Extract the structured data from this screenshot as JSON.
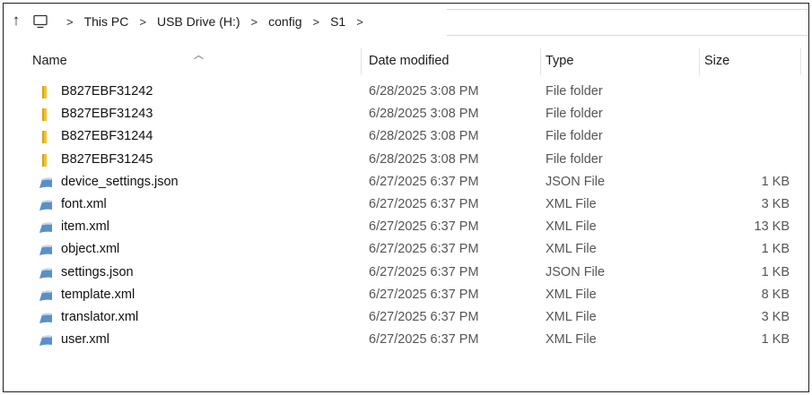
{
  "address_bar": {
    "up_icon": "arrow-up-icon",
    "pc_icon": "monitor-icon",
    "separator": ">",
    "crumbs": [
      "This PC",
      "USB Drive (H:)",
      "config",
      "S1"
    ]
  },
  "columns": {
    "name": "Name",
    "date_modified": "Date modified",
    "type": "Type",
    "size": "Size"
  },
  "rows": [
    {
      "icon": "folder-icon",
      "name": "B827EBF31242",
      "date": "6/28/2025 3:08 PM",
      "type": "File folder",
      "size": ""
    },
    {
      "icon": "folder-icon",
      "name": "B827EBF31243",
      "date": "6/28/2025 3:08 PM",
      "type": "File folder",
      "size": ""
    },
    {
      "icon": "folder-icon",
      "name": "B827EBF31244",
      "date": "6/28/2025 3:08 PM",
      "type": "File folder",
      "size": ""
    },
    {
      "icon": "folder-icon",
      "name": "B827EBF31245",
      "date": "6/28/2025 3:08 PM",
      "type": "File folder",
      "size": ""
    },
    {
      "icon": "file-icon",
      "name": "device_settings.json",
      "date": "6/27/2025 6:37 PM",
      "type": "JSON File",
      "size": "1 KB"
    },
    {
      "icon": "file-icon",
      "name": "font.xml",
      "date": "6/27/2025 6:37 PM",
      "type": "XML File",
      "size": "3 KB"
    },
    {
      "icon": "file-icon",
      "name": "item.xml",
      "date": "6/27/2025 6:37 PM",
      "type": "XML File",
      "size": "13 KB"
    },
    {
      "icon": "file-icon",
      "name": "object.xml",
      "date": "6/27/2025 6:37 PM",
      "type": "XML File",
      "size": "1 KB"
    },
    {
      "icon": "file-icon",
      "name": "settings.json",
      "date": "6/27/2025 6:37 PM",
      "type": "JSON File",
      "size": "1 KB"
    },
    {
      "icon": "file-icon",
      "name": "template.xml",
      "date": "6/27/2025 6:37 PM",
      "type": "XML File",
      "size": "8 KB"
    },
    {
      "icon": "file-icon",
      "name": "translator.xml",
      "date": "6/27/2025 6:37 PM",
      "type": "XML File",
      "size": "3 KB"
    },
    {
      "icon": "file-icon",
      "name": "user.xml",
      "date": "6/27/2025 6:37 PM",
      "type": "XML File",
      "size": "1 KB"
    }
  ],
  "colors": {
    "folder": "#f2c230",
    "file": "#5b8fc7"
  }
}
